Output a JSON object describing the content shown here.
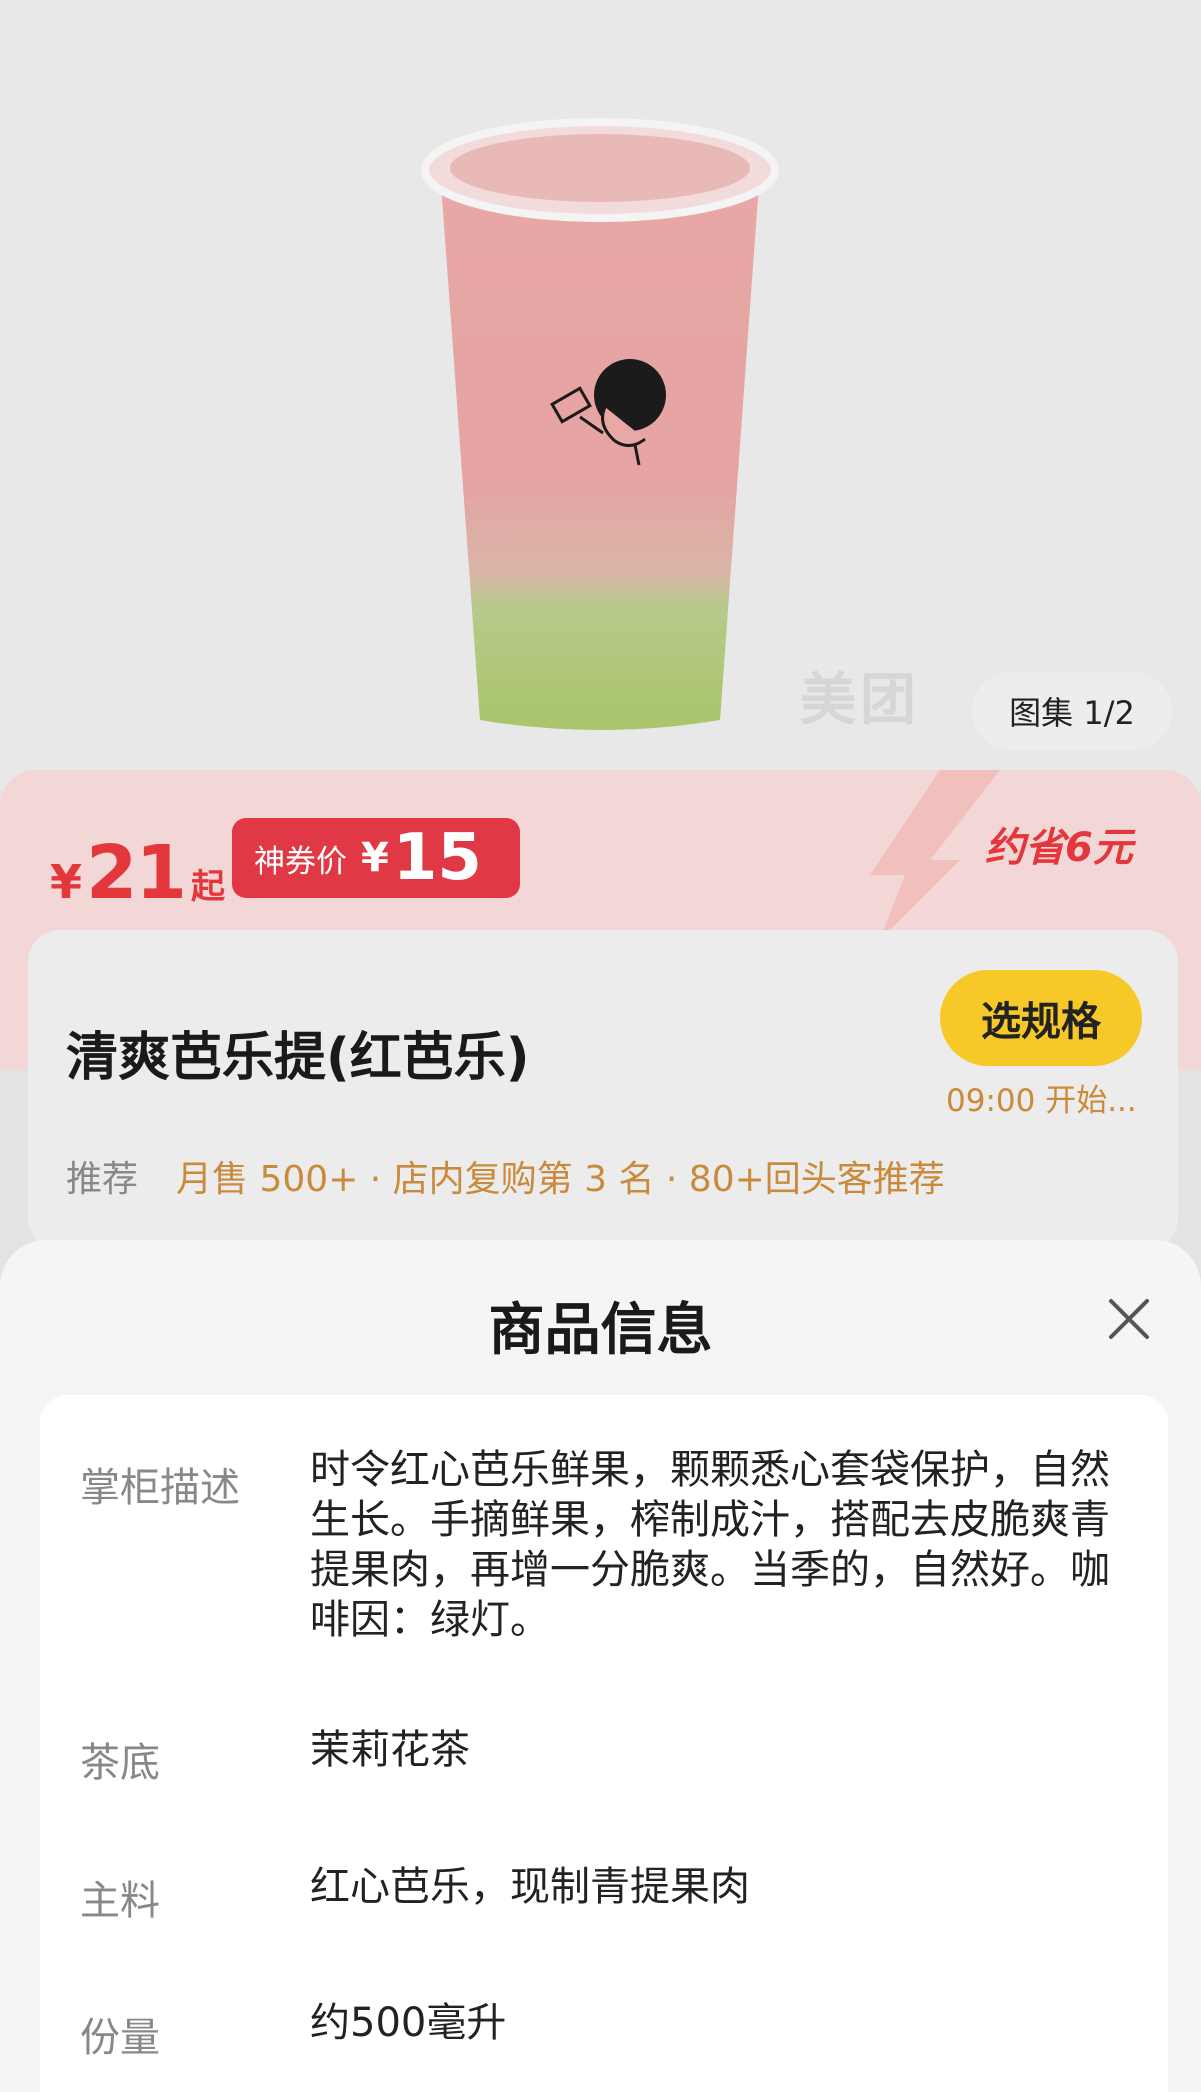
{
  "gallery": {
    "label": "图集 1/2"
  },
  "watermark": "美团",
  "price": {
    "symbol": "¥",
    "amount": "21",
    "suffix": "起"
  },
  "coupon": {
    "label": "神券价",
    "symbol": "¥",
    "amount": "15"
  },
  "savings": "约省6元",
  "product": {
    "name": "清爽芭乐提(红芭乐)",
    "recommend_tag": "推荐",
    "stats": "月售 500+ · 店内复购第 3 名 · 80+回头客推荐"
  },
  "spec_button": {
    "label": "选规格",
    "sale_time": "09:00 开始..."
  },
  "sheet": {
    "title": "商品信息",
    "rows": [
      {
        "label": "掌柜描述",
        "value": "时令红心芭乐鲜果，颗颗悉心套袋保护，自然生长。手摘鲜果，榨制成汁，搭配去皮脆爽青提果肉，再增一分脆爽。当季的，自然好。咖啡因：绿灯。"
      },
      {
        "label": "茶底",
        "value": "茉莉花茶"
      },
      {
        "label": "主料",
        "value": "红心芭乐，现制青提果肉"
      },
      {
        "label": "份量",
        "value": "约500毫升"
      }
    ]
  },
  "colors": {
    "accent_red": "#e4373c",
    "coupon_red": "#e03845",
    "spec_yellow": "#f7c928",
    "meta_orange": "#c98a3c"
  }
}
